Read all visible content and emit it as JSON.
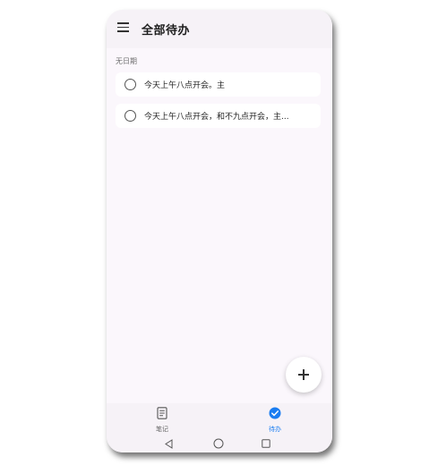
{
  "header": {
    "title": "全部待办",
    "menu_icon": "hamburger-menu-icon"
  },
  "sections": [
    {
      "label": "无日期",
      "items": [
        {
          "text": "今天上午八点开会。主"
        },
        {
          "text": "今天上午八点开会，和不九点开会，主..."
        }
      ]
    }
  ],
  "fab": {
    "icon": "plus-icon"
  },
  "bottom_nav": {
    "items": [
      {
        "label": "笔记",
        "icon": "note-icon",
        "active": false
      },
      {
        "label": "待办",
        "icon": "check-circle-icon",
        "active": true
      }
    ]
  },
  "system_nav": {
    "buttons": [
      "back-icon",
      "home-icon",
      "recents-icon"
    ]
  },
  "colors": {
    "accent": "#1a7df1",
    "background": "#fbf7fc",
    "bar": "#f6f2f7",
    "card": "#ffffff",
    "text": "#1c1c1c",
    "muted": "#6f6f6f"
  }
}
